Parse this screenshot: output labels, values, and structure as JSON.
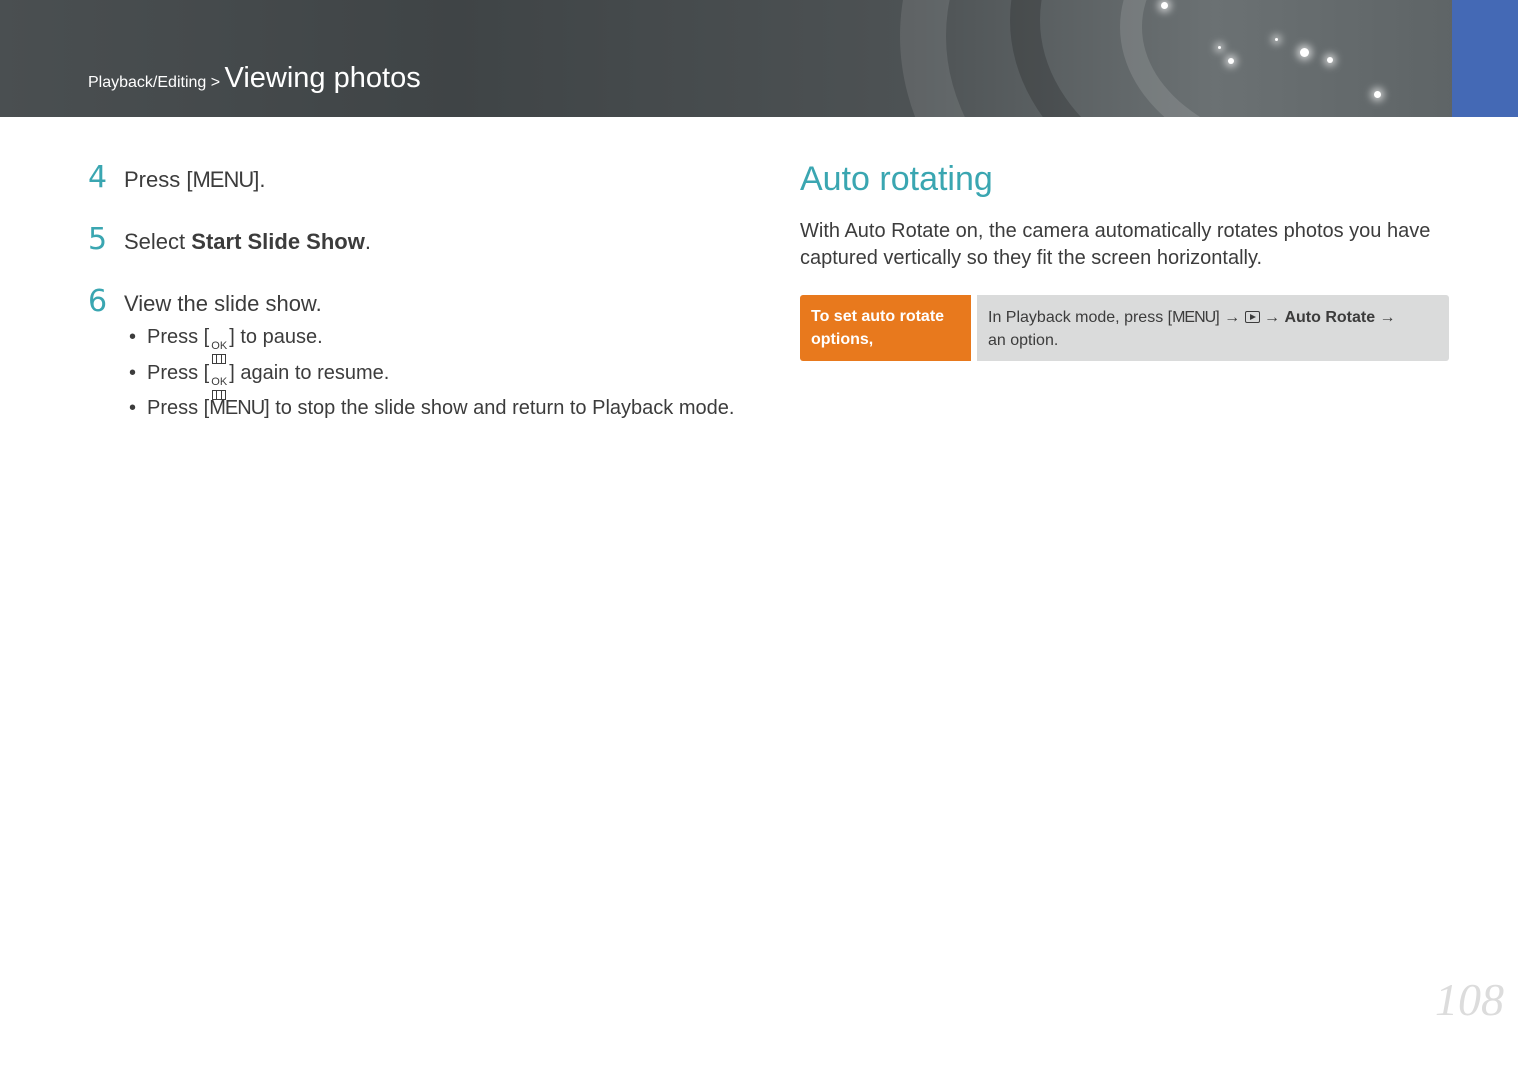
{
  "header": {
    "breadcrumb_section": "Playback/Editing",
    "breadcrumb_separator": " > ",
    "title": "Viewing photos",
    "accent_color": "#4469b5"
  },
  "steps": [
    {
      "number": "4",
      "prefix": "Press [",
      "key": "MENU",
      "suffix": "]."
    },
    {
      "number": "5",
      "prefix": "Select ",
      "bold": "Start Slide Show",
      "suffix": "."
    },
    {
      "number": "6",
      "text": "View the slide show."
    }
  ],
  "bullets": [
    {
      "prefix": "Press [",
      "key_icon": "OK",
      "suffix": "] to pause."
    },
    {
      "prefix": "Press [",
      "key_icon": "OK",
      "suffix": "] again to resume."
    },
    {
      "prefix": "Press [",
      "key": "MENU",
      "suffix": "] to stop the slide show and return to Playback mode."
    }
  ],
  "section": {
    "title": "Auto rotating",
    "intro": "With Auto Rotate on, the camera automatically rotates photos you have captured vertically so they fit the screen horizontally.",
    "howto_label": "To set auto rotate options,",
    "howto_prefix": "In Playback mode, press [",
    "howto_key": "MENU",
    "howto_after_key": "] → ",
    "howto_arrow": " → ",
    "howto_bold": "Auto Rotate",
    "howto_after_bold": " →",
    "howto_end": "an option.",
    "label_color": "#e8791d",
    "title_color": "#3aa6b1"
  },
  "page_number": "108"
}
